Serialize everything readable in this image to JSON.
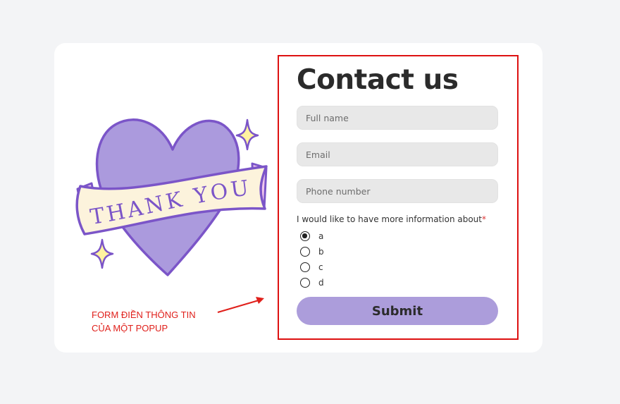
{
  "contact": {
    "title": "Contact us",
    "fields": {
      "full_name_placeholder": "Full name",
      "email_placeholder": "Email",
      "phone_placeholder": "Phone number"
    },
    "question": "I would like to have more information about",
    "required_mark": "*",
    "options": [
      "a",
      "b",
      "c",
      "d"
    ],
    "selected_option": "a",
    "submit_label": "Submit"
  },
  "illustration": {
    "banner_text": "THANK YOU",
    "heart_color": "#ab9add",
    "outline_color": "#7b55c8",
    "ribbon_color": "#fcf3dc",
    "sparkle_color": "#fff3a0"
  },
  "annotation": {
    "line1": "FORM ĐIỀN THÔNG TIN",
    "line2": "CỦA MỘT POPUP",
    "color": "#e0201b"
  },
  "colors": {
    "accent": "#ac9ddb",
    "highlight_border": "#dd1111",
    "field_bg": "#e8e8e8"
  }
}
